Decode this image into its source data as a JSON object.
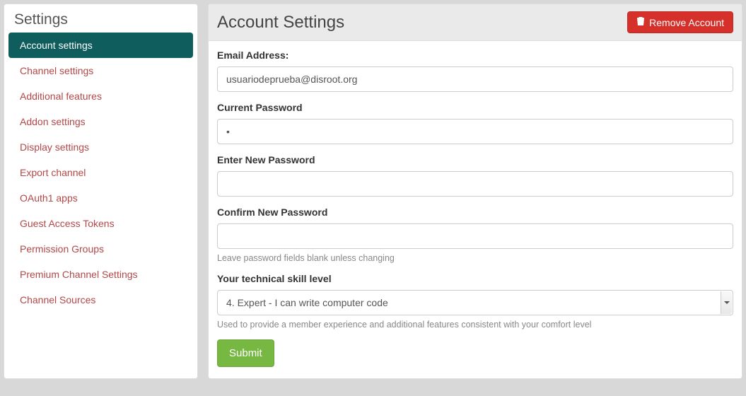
{
  "sidebar": {
    "title": "Settings",
    "items": [
      {
        "label": "Account settings",
        "active": true
      },
      {
        "label": "Channel settings",
        "active": false
      },
      {
        "label": "Additional features",
        "active": false
      },
      {
        "label": "Addon settings",
        "active": false
      },
      {
        "label": "Display settings",
        "active": false
      },
      {
        "label": "Export channel",
        "active": false
      },
      {
        "label": "OAuth1 apps",
        "active": false
      },
      {
        "label": "Guest Access Tokens",
        "active": false
      },
      {
        "label": "Permission Groups",
        "active": false
      },
      {
        "label": "Premium Channel Settings",
        "active": false
      },
      {
        "label": "Channel Sources",
        "active": false
      }
    ]
  },
  "main": {
    "title": "Account Settings",
    "remove_label": "Remove Account"
  },
  "form": {
    "email_label": "Email Address:",
    "email_value": "usuariodeprueba@disroot.org",
    "current_pw_label": "Current Password",
    "current_pw_value": "•",
    "new_pw_label": "Enter New Password",
    "new_pw_value": "",
    "confirm_pw_label": "Confirm New Password",
    "confirm_pw_value": "",
    "pw_help": "Leave password fields blank unless changing",
    "skill_label": "Your technical skill level",
    "skill_value": "4. Expert - I can write computer code",
    "skill_help": "Used to provide a member experience and additional features consistent with your comfort level",
    "submit_label": "Submit"
  }
}
